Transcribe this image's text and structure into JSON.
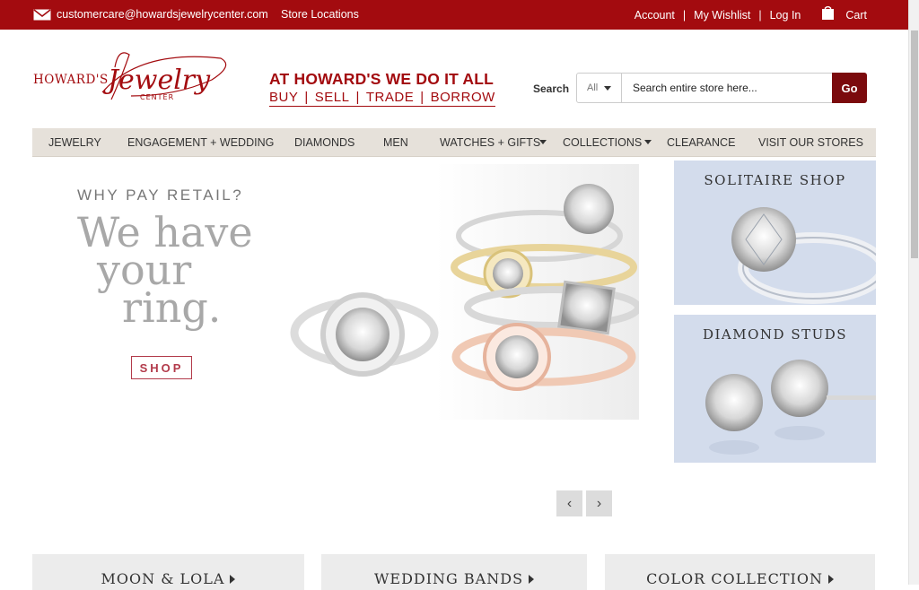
{
  "topbar": {
    "email": "customercare@howardsjewelrycenter.com",
    "store_locations": "Store Locations",
    "account": "Account",
    "wishlist": "My Wishlist",
    "login": "Log In",
    "cart": "Cart",
    "separator": "|"
  },
  "header": {
    "logo_text": "HOWARD'S Jewelry CENTER",
    "tagline_1": "AT HOWARD'S WE DO IT ALL",
    "tagline_items": [
      "BUY",
      "SELL",
      "TRADE",
      "BORROW"
    ],
    "tagline_sep": "|"
  },
  "search": {
    "label": "Search",
    "scope": "All",
    "placeholder": "Search entire store here...",
    "go": "Go"
  },
  "nav": {
    "items": [
      "JEWELRY",
      "ENGAGEMENT + WEDDING",
      "DIAMONDS",
      "MEN",
      "WATCHES + GIFTS",
      "COLLECTIONS",
      "CLEARANCE",
      "VISIT OUR STORES"
    ]
  },
  "hero": {
    "kicker": "WHY PAY RETAIL?",
    "line1": "We have",
    "line2": "your",
    "line3": "ring.",
    "cta": "SHOP",
    "prev": "‹",
    "next": "›"
  },
  "promos": [
    {
      "title": "SOLITAIRE SHOP"
    },
    {
      "title": "DIAMOND STUDS"
    }
  ],
  "cards": [
    {
      "title": "MOON & LOLA"
    },
    {
      "title": "WEDDING BANDS"
    },
    {
      "title": "COLOR COLLECTION"
    }
  ],
  "colors": {
    "brand": "#a30b0f",
    "go_button": "#7b0a0d",
    "nav_bg": "#e6e1da",
    "promo_bg": "#d3dcec"
  }
}
